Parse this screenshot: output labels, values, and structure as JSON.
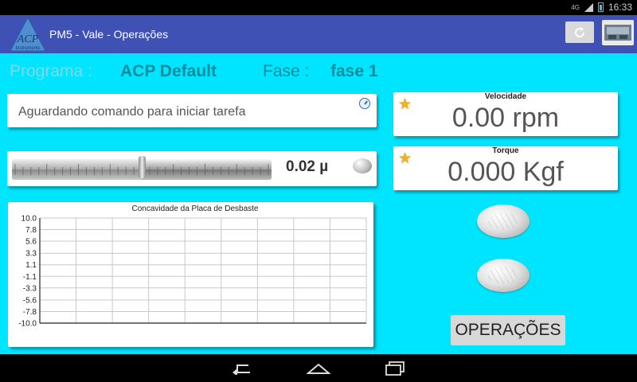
{
  "status_bar": {
    "network": "4G",
    "time": "16:33"
  },
  "app": {
    "title": "PM5 - Vale - Operações",
    "logo_text": "ACP",
    "logo_subtext": "Instruments"
  },
  "info": {
    "program_label": "Programa :",
    "program_value": "ACP Default",
    "phase_label": "Fase :",
    "phase_value": "fase 1"
  },
  "status_message": "Aguardando comando para iniciar tarefa",
  "slider": {
    "value_text": "0.02 µ",
    "position_fraction": 0.5
  },
  "metrics": {
    "velocity": {
      "label": "Velocidade",
      "value": "0.00 rpm"
    },
    "torque": {
      "label": "Torque",
      "value": "0.000 Kgf"
    }
  },
  "operations_button": "OPERAÇÕES",
  "colors": {
    "background": "#00e5ff",
    "action_bar": "#3f51b5",
    "accent_teal": "#008c9c",
    "series_line": "#e02020"
  },
  "icons": [
    "refresh-icon",
    "machine-icon",
    "gauge-icon",
    "star-icon",
    "back-icon",
    "home-icon",
    "recents-icon"
  ],
  "chart_data": {
    "type": "line",
    "title": "Concavidade da Placa de Desbaste",
    "y_ticks": [
      "10.0",
      "7.8",
      "5.6",
      "3.3",
      "1.1",
      "-1.1",
      "-3.3",
      "-5.6",
      "-7.8",
      "-10.0"
    ],
    "ylim": [
      -10.0,
      10.0
    ],
    "xlim": [
      0,
      9
    ],
    "x_gridlines": 9,
    "grid": true,
    "series": [
      {
        "x": [
          0,
          9
        ],
        "y": [
          0,
          0
        ],
        "color": "#e02020"
      }
    ]
  }
}
